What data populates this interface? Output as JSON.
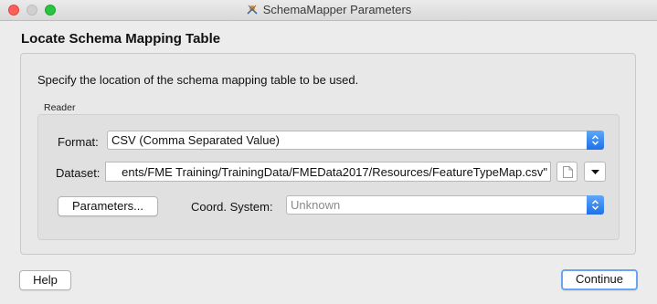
{
  "window": {
    "title": "SchemaMapper Parameters",
    "app_icon": "schemamapper-icon"
  },
  "dialog": {
    "heading": "Locate Schema Mapping Table",
    "description": "Specify the location of the schema mapping table to be used.",
    "group_label": "Reader",
    "format": {
      "label": "Format:",
      "value": "CSV (Comma Separated Value)"
    },
    "dataset": {
      "label": "Dataset:",
      "value": "ents/FME Training/TrainingData/FMEData2017/Resources/FeatureTypeMap.csv\""
    },
    "parameters_button": "Parameters...",
    "coord_system": {
      "label": "Coord. System:",
      "value": "Unknown"
    }
  },
  "footer": {
    "help_label": "Help",
    "continue_label": "Continue"
  },
  "colors": {
    "accent": "#1f70e8",
    "close": "#fc5f57",
    "zoom": "#29c440"
  }
}
